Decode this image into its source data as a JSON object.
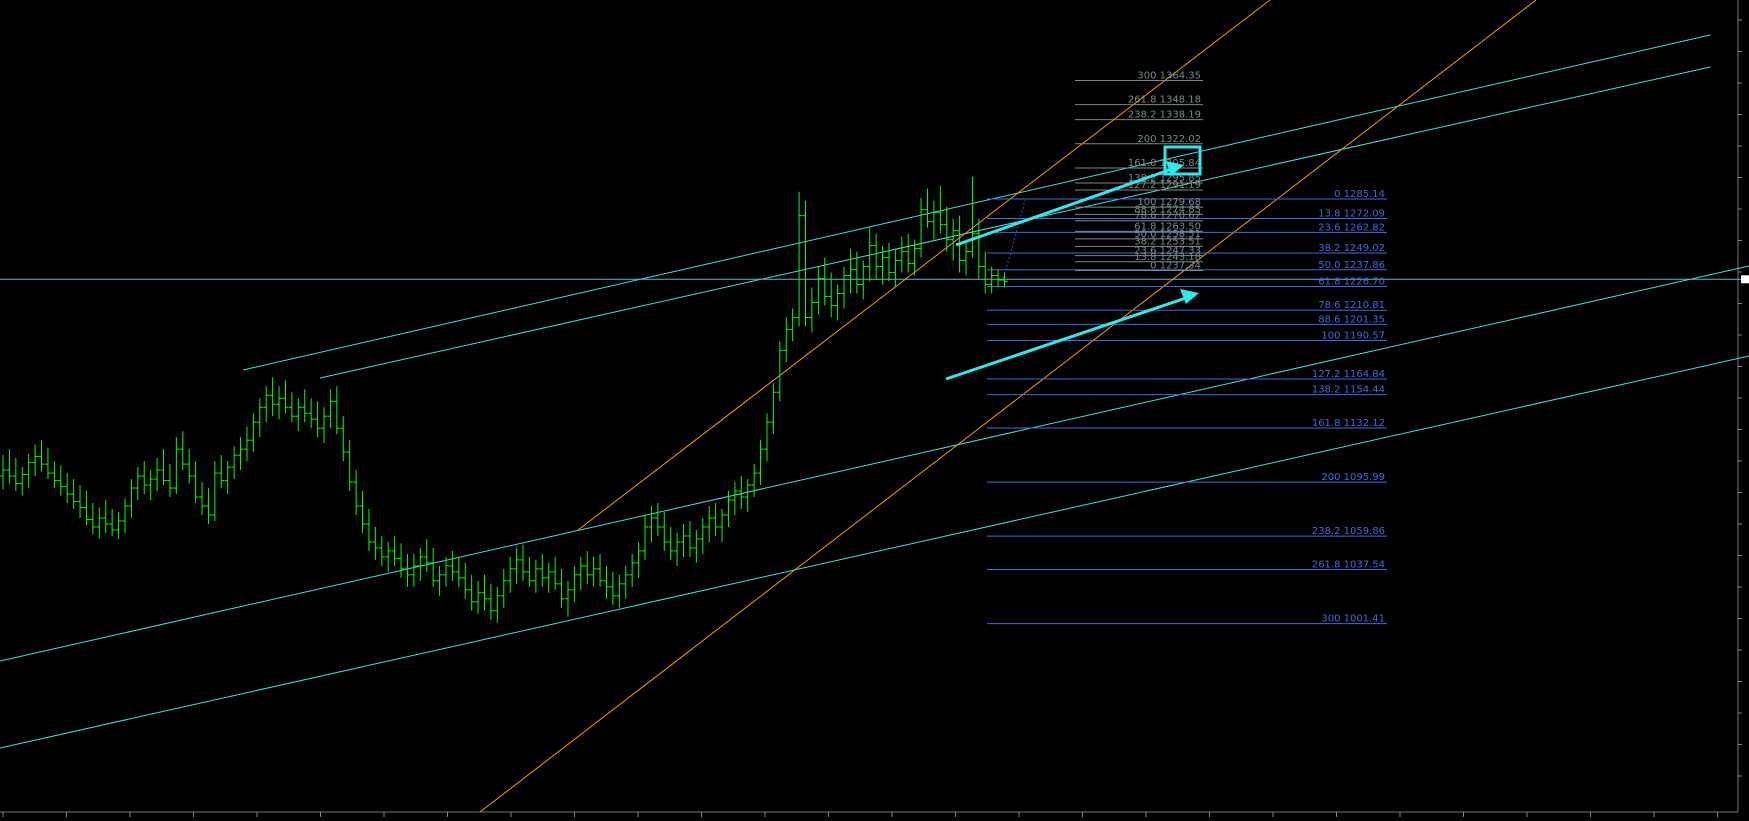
{
  "chart_data": {
    "type": "ohlc",
    "colors": {
      "background": "#000000",
      "bars": "#00ff00",
      "trend_channel": "#40e0e0",
      "orange_channel": "#ff9900",
      "fib_blue": "#4169e1",
      "fib_gray": "#7a8a8a",
      "arrow": "#33e6ee",
      "current_price_line": "#5fb8d6"
    },
    "price_axis": {
      "visible_range": [
        960,
        1390
      ],
      "tick_labels_legible": false
    },
    "time_axis": {
      "tick_labels_legible": false
    },
    "current_price": 1231.5,
    "fib_levels_main": [
      {
        "label": "0 1285.14",
        "price": 1285.14
      },
      {
        "label": "13.8 1272.09",
        "price": 1272.09
      },
      {
        "label": "23.6 1262.82",
        "price": 1262.82
      },
      {
        "label": "38.2 1249.02",
        "price": 1249.02
      },
      {
        "label": "50.0 1237.86",
        "price": 1237.86
      },
      {
        "label": "61.8 1226.70",
        "price": 1226.7
      },
      {
        "label": "78.6 1210.81",
        "price": 1210.81
      },
      {
        "label": "88.6 1201.35",
        "price": 1201.35
      },
      {
        "label": "100 1190.57",
        "price": 1190.57
      },
      {
        "label": "127.2 1164.84",
        "price": 1164.84
      },
      {
        "label": "138.2 1154.44",
        "price": 1154.44
      },
      {
        "label": "161.8 1132.12",
        "price": 1132.12
      },
      {
        "label": "200 1095.99",
        "price": 1095.99
      },
      {
        "label": "238.2 1059.86",
        "price": 1059.86
      },
      {
        "label": "261.8 1037.54",
        "price": 1037.54
      },
      {
        "label": "300 1001.41",
        "price": 1001.41
      }
    ],
    "fib_levels_secondary": [
      {
        "label": "300 1364.35",
        "price": 1364.35
      },
      {
        "label": "261.8 1348.18",
        "price": 1348.18
      },
      {
        "label": "238.2 1338.19",
        "price": 1338.19
      },
      {
        "label": "200 1322.02",
        "price": 1322.02
      },
      {
        "label": "161.8 1305.84",
        "price": 1305.84
      },
      {
        "label": "138.2 1295.85",
        "price": 1295.85
      },
      {
        "label": "127.2 1291.19",
        "price": 1291.19
      },
      {
        "label": "100 1279.68",
        "price": 1279.68
      },
      {
        "label": "88.6 1274.85",
        "price": 1274.85
      },
      {
        "label": "78.6 1270.62",
        "price": 1270.62
      },
      {
        "label": "61.8 1263.50",
        "price": 1263.5
      },
      {
        "label": "50.0 1258.51",
        "price": 1258.51
      },
      {
        "label": "38.2 1253.51",
        "price": 1253.51
      },
      {
        "label": "23.6 1247.33",
        "price": 1247.33
      },
      {
        "label": "13.8 1243.18",
        "price": 1243.18
      },
      {
        "label": "0 1237.34",
        "price": 1237.34
      }
    ],
    "ohlc": [
      [
        1100,
        1114,
        1091,
        1104
      ],
      [
        1104,
        1118,
        1095,
        1100
      ],
      [
        1100,
        1112,
        1090,
        1095
      ],
      [
        1095,
        1106,
        1087,
        1101
      ],
      [
        1101,
        1115,
        1092,
        1109
      ],
      [
        1109,
        1121,
        1100,
        1113
      ],
      [
        1113,
        1124,
        1103,
        1108
      ],
      [
        1108,
        1119,
        1098,
        1102
      ],
      [
        1102,
        1110,
        1092,
        1097
      ],
      [
        1097,
        1107,
        1087,
        1093
      ],
      [
        1093,
        1102,
        1082,
        1088
      ],
      [
        1088,
        1098,
        1078,
        1083
      ],
      [
        1083,
        1094,
        1072,
        1079
      ],
      [
        1079,
        1090,
        1067,
        1071
      ],
      [
        1071,
        1082,
        1061,
        1066
      ],
      [
        1066,
        1079,
        1058,
        1072
      ],
      [
        1072,
        1084,
        1062,
        1068
      ],
      [
        1068,
        1078,
        1060,
        1064
      ],
      [
        1064,
        1076,
        1058,
        1070
      ],
      [
        1070,
        1085,
        1062,
        1080
      ],
      [
        1080,
        1098,
        1072,
        1092
      ],
      [
        1092,
        1106,
        1084,
        1100
      ],
      [
        1100,
        1110,
        1088,
        1094
      ],
      [
        1094,
        1104,
        1084,
        1098
      ],
      [
        1098,
        1112,
        1090,
        1104
      ],
      [
        1104,
        1118,
        1094,
        1097
      ],
      [
        1097,
        1108,
        1086,
        1092
      ],
      [
        1092,
        1126,
        1088,
        1118
      ],
      [
        1118,
        1130,
        1104,
        1108
      ],
      [
        1108,
        1118,
        1095,
        1100
      ],
      [
        1100,
        1110,
        1082,
        1086
      ],
      [
        1086,
        1096,
        1074,
        1080
      ],
      [
        1080,
        1092,
        1068,
        1074
      ],
      [
        1074,
        1110,
        1070,
        1102
      ],
      [
        1102,
        1114,
        1092,
        1097
      ],
      [
        1097,
        1110,
        1088,
        1106
      ],
      [
        1106,
        1120,
        1098,
        1114
      ],
      [
        1114,
        1126,
        1104,
        1118
      ],
      [
        1118,
        1133,
        1110,
        1124
      ],
      [
        1124,
        1142,
        1116,
        1136
      ],
      [
        1136,
        1152,
        1126,
        1146
      ],
      [
        1146,
        1160,
        1136,
        1154
      ],
      [
        1154,
        1166,
        1140,
        1148
      ],
      [
        1148,
        1160,
        1138,
        1152
      ],
      [
        1152,
        1164,
        1142,
        1146
      ],
      [
        1146,
        1156,
        1136,
        1140
      ],
      [
        1140,
        1152,
        1130,
        1146
      ],
      [
        1146,
        1158,
        1136,
        1142
      ],
      [
        1142,
        1152,
        1132,
        1138
      ],
      [
        1138,
        1150,
        1126,
        1132
      ],
      [
        1132,
        1146,
        1122,
        1140
      ],
      [
        1140,
        1158,
        1132,
        1150
      ],
      [
        1150,
        1160,
        1128,
        1132
      ],
      [
        1132,
        1140,
        1110,
        1116
      ],
      [
        1116,
        1124,
        1090,
        1096
      ],
      [
        1096,
        1104,
        1074,
        1080
      ],
      [
        1080,
        1090,
        1062,
        1068
      ],
      [
        1068,
        1078,
        1050,
        1056
      ],
      [
        1056,
        1066,
        1044,
        1052
      ],
      [
        1052,
        1060,
        1040,
        1046
      ],
      [
        1046,
        1056,
        1036,
        1050
      ],
      [
        1050,
        1060,
        1040,
        1045
      ],
      [
        1045,
        1055,
        1032,
        1038
      ],
      [
        1038,
        1048,
        1026,
        1034
      ],
      [
        1034,
        1048,
        1026,
        1040
      ],
      [
        1040,
        1052,
        1030,
        1046
      ],
      [
        1046,
        1058,
        1036,
        1042
      ],
      [
        1042,
        1052,
        1026,
        1030
      ],
      [
        1030,
        1040,
        1020,
        1034
      ],
      [
        1034,
        1046,
        1026,
        1040
      ],
      [
        1040,
        1050,
        1030,
        1036
      ],
      [
        1036,
        1046,
        1026,
        1032
      ],
      [
        1032,
        1042,
        1018,
        1024
      ],
      [
        1024,
        1034,
        1010,
        1016
      ],
      [
        1016,
        1030,
        1008,
        1022
      ],
      [
        1022,
        1034,
        1010,
        1018
      ],
      [
        1018,
        1028,
        1004,
        1010
      ],
      [
        1010,
        1026,
        1002,
        1020
      ],
      [
        1020,
        1038,
        1012,
        1030
      ],
      [
        1030,
        1046,
        1022,
        1038
      ],
      [
        1038,
        1052,
        1028,
        1044
      ],
      [
        1044,
        1054,
        1030,
        1036
      ],
      [
        1036,
        1046,
        1026,
        1030
      ],
      [
        1030,
        1044,
        1022,
        1038
      ],
      [
        1038,
        1048,
        1026,
        1032
      ],
      [
        1032,
        1042,
        1022,
        1036
      ],
      [
        1036,
        1046,
        1024,
        1028
      ],
      [
        1028,
        1038,
        1012,
        1018
      ],
      [
        1018,
        1030,
        1006,
        1024
      ],
      [
        1024,
        1040,
        1016,
        1034
      ],
      [
        1034,
        1046,
        1024,
        1040
      ],
      [
        1040,
        1050,
        1028,
        1034
      ],
      [
        1034,
        1046,
        1026,
        1038
      ],
      [
        1038,
        1048,
        1026,
        1030
      ],
      [
        1030,
        1040,
        1018,
        1026
      ],
      [
        1026,
        1036,
        1014,
        1020
      ],
      [
        1020,
        1034,
        1012,
        1028
      ],
      [
        1028,
        1040,
        1018,
        1034
      ],
      [
        1034,
        1048,
        1026,
        1042
      ],
      [
        1042,
        1056,
        1032,
        1050
      ],
      [
        1050,
        1074,
        1044,
        1066
      ],
      [
        1066,
        1080,
        1056,
        1072
      ],
      [
        1072,
        1082,
        1060,
        1066
      ],
      [
        1066,
        1076,
        1050,
        1056
      ],
      [
        1056,
        1066,
        1044,
        1050
      ],
      [
        1050,
        1062,
        1040,
        1056
      ],
      [
        1056,
        1068,
        1046,
        1060
      ],
      [
        1060,
        1070,
        1046,
        1052
      ],
      [
        1052,
        1064,
        1042,
        1058
      ],
      [
        1058,
        1072,
        1048,
        1066
      ],
      [
        1066,
        1080,
        1056,
        1072
      ],
      [
        1072,
        1082,
        1060,
        1066
      ],
      [
        1066,
        1078,
        1056,
        1074
      ],
      [
        1074,
        1090,
        1066,
        1084
      ],
      [
        1084,
        1096,
        1074,
        1090
      ],
      [
        1090,
        1100,
        1078,
        1086
      ],
      [
        1086,
        1098,
        1076,
        1094
      ],
      [
        1094,
        1108,
        1086,
        1102
      ],
      [
        1102,
        1124,
        1094,
        1118
      ],
      [
        1118,
        1142,
        1110,
        1136
      ],
      [
        1136,
        1162,
        1128,
        1156
      ],
      [
        1156,
        1190,
        1150,
        1184
      ],
      [
        1184,
        1206,
        1176,
        1198
      ],
      [
        1198,
        1212,
        1190,
        1206
      ],
      [
        1206,
        1290,
        1200,
        1274
      ],
      [
        1274,
        1284,
        1200,
        1206
      ],
      [
        1206,
        1226,
        1196,
        1216
      ],
      [
        1216,
        1240,
        1208,
        1232
      ],
      [
        1232,
        1246,
        1214,
        1220
      ],
      [
        1220,
        1236,
        1206,
        1214
      ],
      [
        1214,
        1228,
        1204,
        1222
      ],
      [
        1222,
        1240,
        1212,
        1234
      ],
      [
        1234,
        1252,
        1222,
        1238
      ],
      [
        1238,
        1250,
        1222,
        1228
      ],
      [
        1228,
        1244,
        1218,
        1240
      ],
      [
        1240,
        1266,
        1230,
        1254
      ],
      [
        1254,
        1262,
        1232,
        1240
      ],
      [
        1240,
        1254,
        1228,
        1246
      ],
      [
        1246,
        1256,
        1230,
        1236
      ],
      [
        1236,
        1252,
        1226,
        1244
      ],
      [
        1244,
        1260,
        1236,
        1250
      ],
      [
        1250,
        1262,
        1236,
        1242
      ],
      [
        1242,
        1258,
        1234,
        1252
      ],
      [
        1252,
        1286,
        1246,
        1278
      ],
      [
        1278,
        1292,
        1266,
        1270
      ],
      [
        1270,
        1284,
        1258,
        1276
      ],
      [
        1276,
        1294,
        1262,
        1268
      ],
      [
        1268,
        1280,
        1250,
        1258
      ],
      [
        1258,
        1272,
        1244,
        1264
      ],
      [
        1264,
        1274,
        1236,
        1244
      ],
      [
        1244,
        1258,
        1234,
        1250
      ],
      [
        1250,
        1300,
        1246,
        1262
      ],
      [
        1262,
        1272,
        1232,
        1240
      ],
      [
        1240,
        1250,
        1222,
        1228
      ],
      [
        1228,
        1240,
        1222,
        1234
      ],
      [
        1234,
        1238,
        1226,
        1231
      ],
      [
        1231,
        1236,
        1226,
        1230
      ]
    ]
  }
}
